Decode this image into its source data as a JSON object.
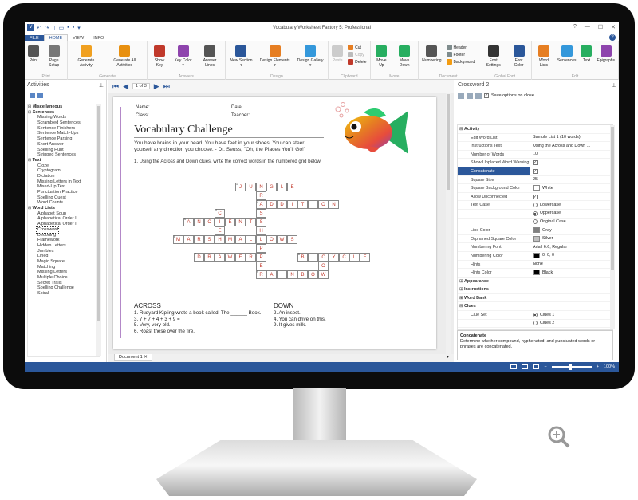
{
  "app": {
    "title": "Vocabulary Worksheet Factory 5: Professional",
    "icon_letter": "V"
  },
  "tabs": [
    "FILE",
    "HOME",
    "VIEW",
    "INFO"
  ],
  "ribbon": {
    "groups": [
      {
        "label": "Print",
        "buttons": [
          {
            "label": "Print",
            "icon": "printer-icon",
            "color": "#555"
          },
          {
            "label": "Page Setup",
            "icon": "page-setup-icon",
            "color": "#777"
          }
        ]
      },
      {
        "label": "Generate",
        "buttons": [
          {
            "label": "Generate Activity",
            "icon": "lightning-icon",
            "color": "#f0a020"
          },
          {
            "label": "Generate All Activities",
            "icon": "lightning-multi-icon",
            "color": "#e89010"
          }
        ]
      },
      {
        "label": "Answers",
        "buttons": [
          {
            "label": "Show Key",
            "icon": "checkmark-icon",
            "color": "#c0392b"
          },
          {
            "label": "Key Color ▾",
            "icon": "palette-icon",
            "color": "#8e44ad"
          },
          {
            "label": "Answer Lines",
            "icon": "lines-icon",
            "color": "#555"
          }
        ]
      },
      {
        "label": "Design",
        "buttons": [
          {
            "label": "New Section ▾",
            "icon": "section-icon",
            "color": "#2b579a"
          },
          {
            "label": "Design Elements ▾",
            "icon": "design-elements-icon",
            "color": "#e67e22"
          },
          {
            "label": "Design Gallery ▾",
            "icon": "gallery-icon",
            "color": "#3498db"
          }
        ]
      },
      {
        "label": "Move",
        "buttons": [
          {
            "label": "Move Up",
            "icon": "arrow-up-icon",
            "color": "#27ae60"
          },
          {
            "label": "Move Down",
            "icon": "arrow-down-icon",
            "color": "#27ae60"
          }
        ]
      },
      {
        "label": "Document",
        "buttons": [
          {
            "label": "Numbering",
            "icon": "numbering-icon",
            "color": "#555"
          }
        ]
      },
      {
        "label": "Global Font",
        "buttons": [
          {
            "label": "Font Settings",
            "icon": "font-icon",
            "color": "#333"
          },
          {
            "label": "Font Color",
            "icon": "font-color-icon",
            "color": "#2b579a"
          }
        ]
      },
      {
        "label": "Edit",
        "buttons": [
          {
            "label": "Word Lists",
            "icon": "word-lists-icon",
            "color": "#e67e22"
          },
          {
            "label": "Sentences",
            "icon": "sentences-icon",
            "color": "#3498db"
          },
          {
            "label": "Text",
            "icon": "text-icon",
            "color": "#27ae60"
          },
          {
            "label": "Epigraphs",
            "icon": "epigraphs-icon",
            "color": "#8e44ad"
          }
        ]
      }
    ],
    "clipboard": {
      "label": "Clipboard",
      "paste": "Paste",
      "cut": "Cut",
      "copy": "Copy",
      "delete": "Delete"
    },
    "document_small": [
      "Header",
      "Footer",
      "Background"
    ]
  },
  "activities_panel": {
    "title": "Activities",
    "tree": [
      {
        "type": "cat",
        "label": "Miscellaneous"
      },
      {
        "type": "cat",
        "label": "Sentences"
      },
      {
        "type": "item",
        "label": "Missing Words"
      },
      {
        "type": "item",
        "label": "Scrambled Sentences"
      },
      {
        "type": "item",
        "label": "Sentence Finishers"
      },
      {
        "type": "item",
        "label": "Sentence Match-Ups"
      },
      {
        "type": "item",
        "label": "Sentence Parsing"
      },
      {
        "type": "item",
        "label": "Short Answer"
      },
      {
        "type": "item",
        "label": "Spelling Hunt"
      },
      {
        "type": "item",
        "label": "Stripped Sentences"
      },
      {
        "type": "cat",
        "label": "Text"
      },
      {
        "type": "item",
        "label": "Cloze"
      },
      {
        "type": "item",
        "label": "Cryptogram"
      },
      {
        "type": "item",
        "label": "Dictation"
      },
      {
        "type": "item",
        "label": "Missing Letters in Text"
      },
      {
        "type": "item",
        "label": "Mixed-Up Text"
      },
      {
        "type": "item",
        "label": "Punctuation Practice"
      },
      {
        "type": "item",
        "label": "Spelling Quest"
      },
      {
        "type": "item",
        "label": "Word Counts"
      },
      {
        "type": "cat",
        "label": "Word Lists"
      },
      {
        "type": "item",
        "label": "Alphabet Soup"
      },
      {
        "type": "item",
        "label": "Alphabetical Order I"
      },
      {
        "type": "item",
        "label": "Alphabetical Order II"
      },
      {
        "type": "sel",
        "label": "Crossword"
      },
      {
        "type": "item",
        "label": "Decoding"
      },
      {
        "type": "item",
        "label": "Framework"
      },
      {
        "type": "item",
        "label": "Hidden Letters"
      },
      {
        "type": "item",
        "label": "Jumbles"
      },
      {
        "type": "item",
        "label": "Lined"
      },
      {
        "type": "item",
        "label": "Magic Square"
      },
      {
        "type": "item",
        "label": "Matching"
      },
      {
        "type": "item",
        "label": "Missing Letters"
      },
      {
        "type": "item",
        "label": "Multiple Choice"
      },
      {
        "type": "item",
        "label": "Secret Trails"
      },
      {
        "type": "item",
        "label": "Spelling Challenge"
      },
      {
        "type": "item",
        "label": "Spiral"
      }
    ]
  },
  "navigator": {
    "page_indicator": "1 of 3"
  },
  "document": {
    "tab_label": "Document 1",
    "fields": {
      "name": "Name:",
      "date": "Date:",
      "class": "Class:",
      "teacher": "Teacher:"
    },
    "title": "Vocabulary Challenge",
    "quote": "You have brains in your head. You have feet in your shoes. You can steer yourself any direction you choose. - Dr. Seuss, \"Oh, the Places You'll Go!\"",
    "instruction": "1.  Using the Across and Down clues, write the correct words in the numbered grid below.",
    "across_title": "ACROSS",
    "across": [
      "1.  Rudyard Kipling wrote a book called, The ______ Book.",
      "3.  7 + 7 + 4 + 3 + 9 =",
      "5.  Very, very old.",
      "6.  Roast these over the fire."
    ],
    "down_title": "DOWN",
    "down": [
      "2.  An insect.",
      "4.  You can drive on this.",
      "9.  It gives milk."
    ]
  },
  "crossword": {
    "words": [
      {
        "word": "JUNGLE",
        "row": 0,
        "col": 5,
        "dir": "across",
        "num": "1"
      },
      {
        "word": "ADDITION",
        "row": 2,
        "col": 7,
        "dir": "across",
        "num": "3"
      },
      {
        "word": "ANCIENT",
        "row": 4,
        "col": 0,
        "dir": "across",
        "num": "5"
      },
      {
        "word": "MARSHMALLOWS",
        "row": 6,
        "col": -1,
        "dir": "across",
        "num": "6"
      },
      {
        "word": "DRAWER",
        "row": 8,
        "col": 1,
        "dir": "across",
        "num": "7"
      },
      {
        "word": "BICYCLE",
        "row": 8,
        "col": 11,
        "dir": "across",
        "num": "8"
      },
      {
        "word": "RAINBOW",
        "row": 10,
        "col": 7,
        "dir": "across",
        "num": "9"
      },
      {
        "word": "GRASSHOPPER",
        "row": 0,
        "col": 7,
        "dir": "down",
        "num": ""
      },
      {
        "word": "CHEW",
        "row": 3,
        "col": 3,
        "dir": "down",
        "num": "4"
      },
      {
        "word": "COW",
        "row": 8,
        "col": 13,
        "dir": "down",
        "num": ""
      }
    ]
  },
  "properties": {
    "title": "Crossword 2",
    "save_label": "Save options on close.",
    "rows": [
      {
        "type": "sec",
        "name": "Activity"
      },
      {
        "name": "Edit Word List",
        "value": "Sample List 1 (10 words)"
      },
      {
        "name": "Instructions Text",
        "value": "Using the Across and Down ..."
      },
      {
        "name": "Number of Words",
        "value": "10"
      },
      {
        "name": "Show Unplaced Word Warning",
        "check": true
      },
      {
        "type": "sel",
        "name": "Concatenate",
        "check": true
      },
      {
        "name": "Square Size",
        "value": "25"
      },
      {
        "name": "Square Background Color",
        "swatch": "#ffffff",
        "value": "White"
      },
      {
        "name": "Allow Unconnected",
        "check": true
      },
      {
        "name": "Text Case",
        "radio": false,
        "value": "Lowercase"
      },
      {
        "name": "",
        "radio": true,
        "value": "Uppercase"
      },
      {
        "name": "",
        "radio": false,
        "value": "Original Case"
      },
      {
        "name": "Line Color",
        "swatch": "#808080",
        "value": "Gray"
      },
      {
        "name": "Orphaned Square Color",
        "swatch": "#c0c0c0",
        "value": "Silver"
      },
      {
        "name": "Numbering Font",
        "value": "Arial, 6.6, Regular"
      },
      {
        "name": "Numbering Color",
        "swatch": "#000000",
        "value": "0, 0, 0"
      },
      {
        "name": "Hints",
        "value": "None"
      },
      {
        "name": "Hints Color",
        "swatch": "#000000",
        "value": "Black"
      },
      {
        "type": "sec",
        "name": "Appearance",
        "collapsed": true
      },
      {
        "type": "sec",
        "name": "Instructions",
        "collapsed": true
      },
      {
        "type": "sec",
        "name": "Word Bank",
        "collapsed": true
      },
      {
        "type": "sec",
        "name": "Clues"
      },
      {
        "name": "Clue Set",
        "radio": true,
        "value": "Clues 1"
      },
      {
        "name": "",
        "radio": false,
        "value": "Clues 2"
      }
    ],
    "desc_title": "Concatenate",
    "desc_text": "Determine whether compound, hyphenated, and punctuated words or phrases are concatenated."
  },
  "status": {
    "zoom": "100%"
  },
  "colors": {
    "accent": "#2b579a",
    "answer": "#c0392b"
  }
}
